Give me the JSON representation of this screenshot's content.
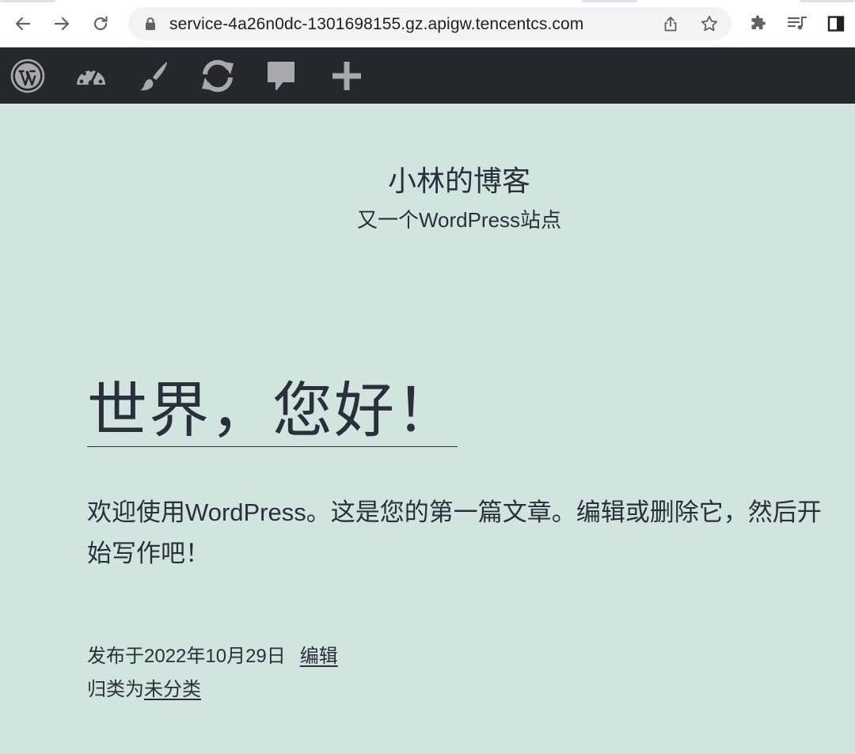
{
  "browser": {
    "url": "service-4a26n0dc-1301698155.gz.apigw.tencentcs.com"
  },
  "admin_bar": {
    "icons": [
      "wordpress-logo-icon",
      "dashboard-icon",
      "customize-brush-icon",
      "updates-icon",
      "comments-icon",
      "new-content-plus-icon"
    ]
  },
  "site": {
    "title": "小林的博客",
    "description": "又一个WordPress站点"
  },
  "post": {
    "title": "世界，您好！",
    "body": "欢迎使用WordPress。这是您的第一篇文章。编辑或删除它，然后开始写作吧！",
    "published_prefix": "发布于",
    "published_date": "2022年10月29日",
    "edit_link": "编辑",
    "category_prefix": "归类为",
    "category": "未分类"
  },
  "colors": {
    "background": "#d1e4dd",
    "admin_bar": "#23282d",
    "text": "#28303d",
    "admin_icon": "#a7aaad"
  }
}
